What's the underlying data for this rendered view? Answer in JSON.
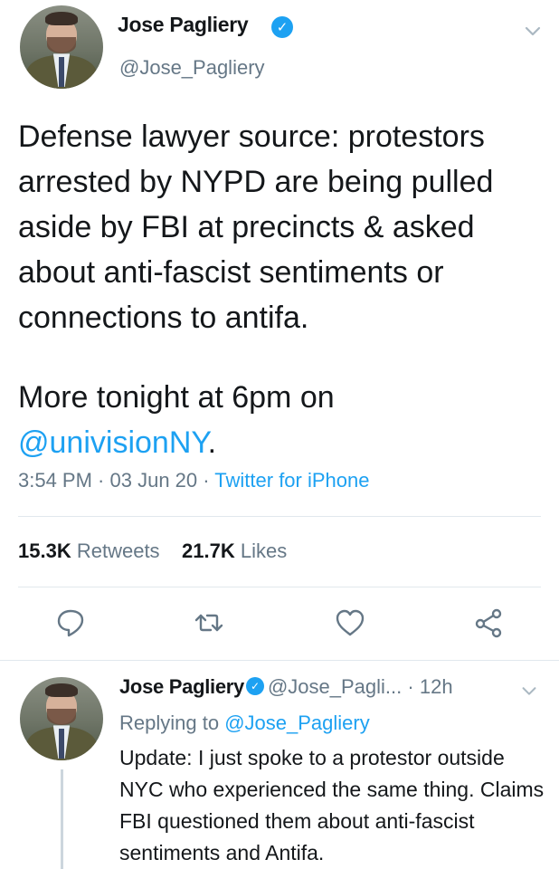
{
  "tweet": {
    "author_name": "Jose Pagliery",
    "author_handle": "@Jose_Pagliery",
    "verified_symbol": "✓",
    "text_main": "Defense lawyer source: protestors\narrested by NYPD are being pulled\naside by FBI at precincts & asked\nabout anti-fascist sentiments or\nconnections to antifa.",
    "text_more_prefix": "More tonight at 6pm on",
    "text_mention": "@univisionNY",
    "text_suffix": ".",
    "time": "3:54 PM",
    "date": "03 Jun 20",
    "source": "Twitter for iPhone",
    "separator": " · "
  },
  "stats": {
    "retweets_count": "15.3K",
    "retweets_label": "Retweets",
    "likes_count": "21.7K",
    "likes_label": "Likes"
  },
  "actions": [
    "reply-icon",
    "retweet-icon",
    "like-icon",
    "share-icon"
  ],
  "reply": {
    "author_name": "Jose Pagliery",
    "author_handle": "@Jose_Pagli...",
    "dot": "·",
    "time": "12h",
    "replying_prefix": "Replying to",
    "replying_handle": "@Jose_Pagliery",
    "text": "Update: I just spoke to a protestor outside NYC who experienced the same thing. Claims FBI questioned them about anti-fascist sentiments and Antifa."
  },
  "colors": {
    "accent": "#1da1f2",
    "secondary_text": "#657786",
    "primary_text": "#14171a",
    "divider": "#e1e8ed"
  }
}
